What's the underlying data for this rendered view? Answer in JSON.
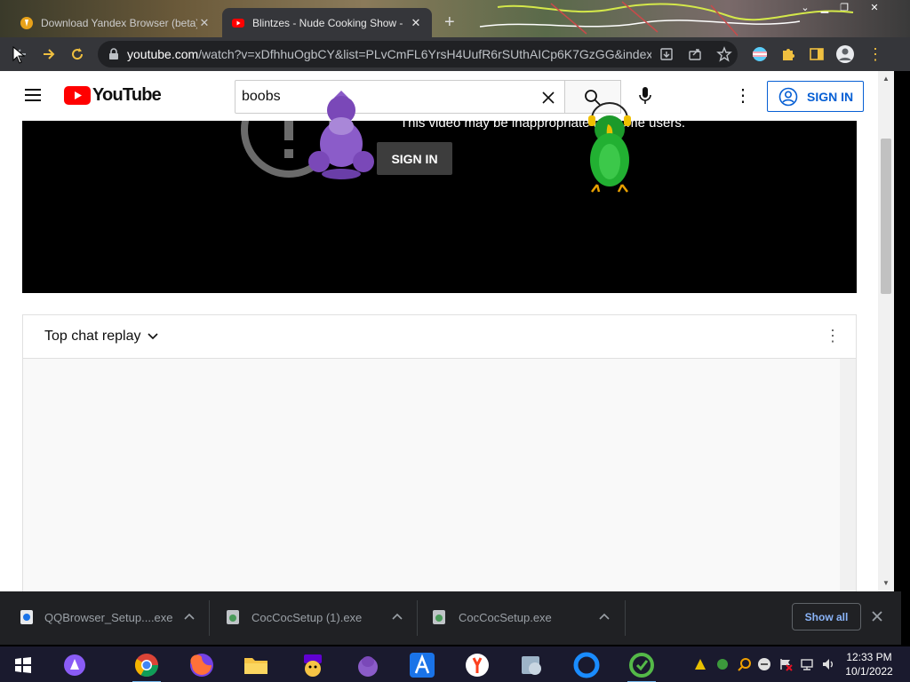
{
  "browser": {
    "tabs": [
      {
        "title": "Download Yandex Browser (beta)",
        "active": false
      },
      {
        "title": "Blintzes - Nude Cooking Show -",
        "active": true
      }
    ],
    "url_host": "youtube.com",
    "url_path": "/watch?v=xDfhhuOgbCY&list=PLvCmFL6YrsH4UufR6rSUthAICp6K7GzGG&index..."
  },
  "youtube": {
    "logo_text": "YouTube",
    "search_value": "boobs",
    "signin_label": "SIGN IN",
    "player": {
      "warning_text": "This video may be inappropriate for some users.",
      "signin_label": "SIGN IN"
    },
    "chat": {
      "header_label": "Top chat replay"
    }
  },
  "downloads": {
    "items": [
      {
        "name": "QQBrowser_Setup....exe"
      },
      {
        "name": "CocCocSetup (1).exe"
      },
      {
        "name": "CocCocSetup.exe"
      }
    ],
    "show_all_label": "Show all"
  },
  "taskbar": {
    "time": "12:33 PM",
    "date": "10/1/2022"
  },
  "colors": {
    "yt_red": "#ff0000",
    "signin_blue": "#065fd4",
    "chrome_dark": "#35363a"
  }
}
